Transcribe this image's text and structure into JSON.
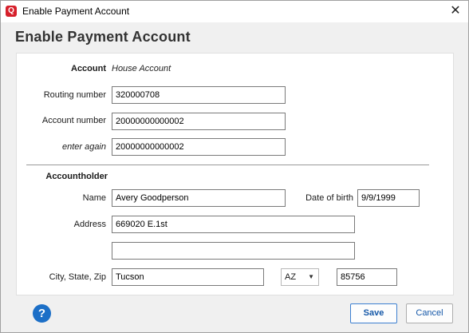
{
  "window": {
    "title": "Enable Payment Account",
    "app_icon_letter": "Q",
    "close_glyph": "✕"
  },
  "heading": "Enable Payment Account",
  "account": {
    "label": "Account",
    "value": "House Account"
  },
  "routing": {
    "label": "Routing number",
    "value": "320000708"
  },
  "account_number": {
    "label": "Account number",
    "value": "20000000000002"
  },
  "enter_again": {
    "label": "enter again",
    "value": "20000000000002"
  },
  "accountholder": {
    "section_label": "Accountholder",
    "name_label": "Name",
    "name_value": "Avery Goodperson",
    "dob_label": "Date of birth",
    "dob_value": "9/9/1999",
    "address_label": "Address",
    "address_line1": "669020 E.1st",
    "address_line2": "",
    "csz_label": "City, State, Zip",
    "city": "Tucson",
    "state": "AZ",
    "zip": "85756"
  },
  "footer": {
    "help_glyph": "?",
    "save_label": "Save",
    "cancel_label": "Cancel"
  },
  "icons": {
    "app": "quicken-logo-icon",
    "close": "close-icon",
    "help": "help-icon",
    "dropdown": "chevron-down-icon"
  },
  "colors": {
    "accent": "#1c6fc7",
    "app_red": "#d6202b",
    "button_text": "#1558a8"
  }
}
